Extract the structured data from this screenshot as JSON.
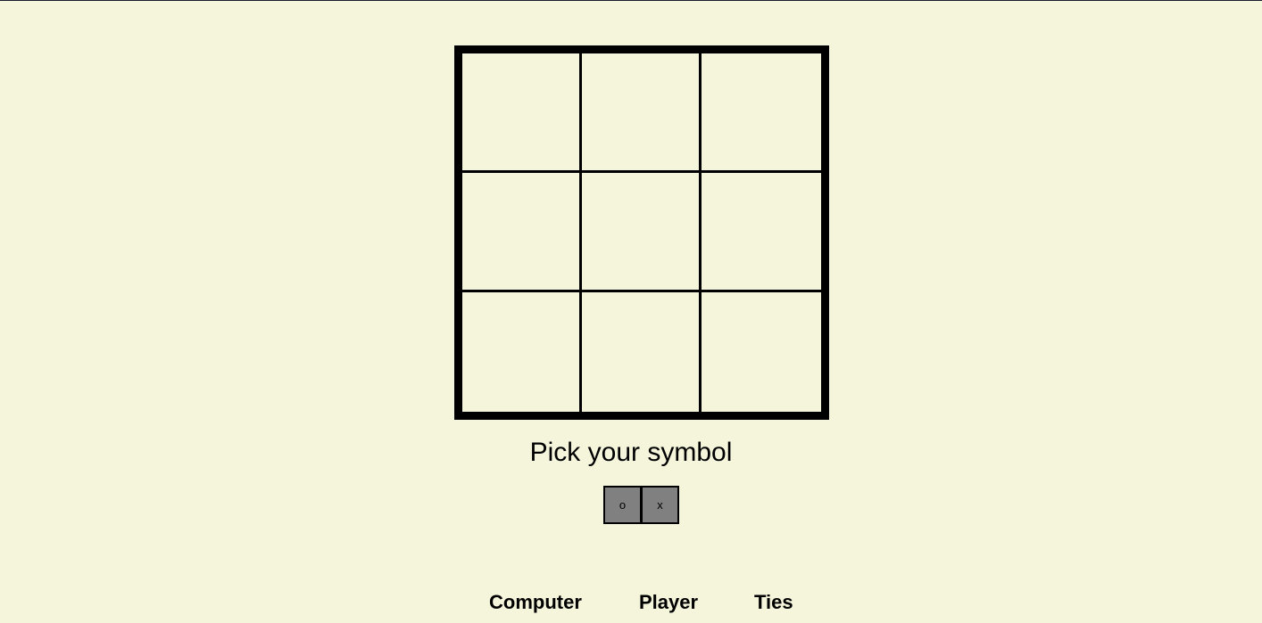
{
  "board": {
    "cells": [
      "",
      "",
      "",
      "",
      "",
      "",
      "",
      "",
      ""
    ]
  },
  "prompt": "Pick your symbol",
  "symbols": {
    "o_label": "o",
    "x_label": "x"
  },
  "scoreboard": {
    "computer_label": "Computer",
    "player_label": "Player",
    "ties_label": "Ties"
  },
  "colors": {
    "background": "#f5f5dc",
    "button": "#808080",
    "lines": "#000000"
  }
}
